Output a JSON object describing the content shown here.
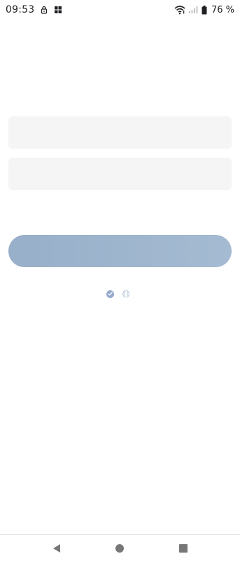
{
  "status_bar": {
    "time": "09:53",
    "battery_percent": "76 %",
    "icons": [
      "lock-icon",
      "app-grid-icon",
      "wifi-icon",
      "cellular-signal-icon",
      "battery-icon"
    ]
  },
  "form": {
    "field_1": {
      "value": "",
      "placeholder": ""
    },
    "field_2": {
      "value": "",
      "placeholder": ""
    },
    "submit_label": ""
  },
  "agreement": {
    "checked": true,
    "link_text": "《》"
  },
  "nav": {
    "icons": [
      "back-icon",
      "home-icon",
      "recents-icon"
    ]
  },
  "colors": {
    "button_start": "#97afc9",
    "button_end": "#a4bbd2",
    "field_bg": "#f5f5f5",
    "accent": "#93aacb"
  }
}
